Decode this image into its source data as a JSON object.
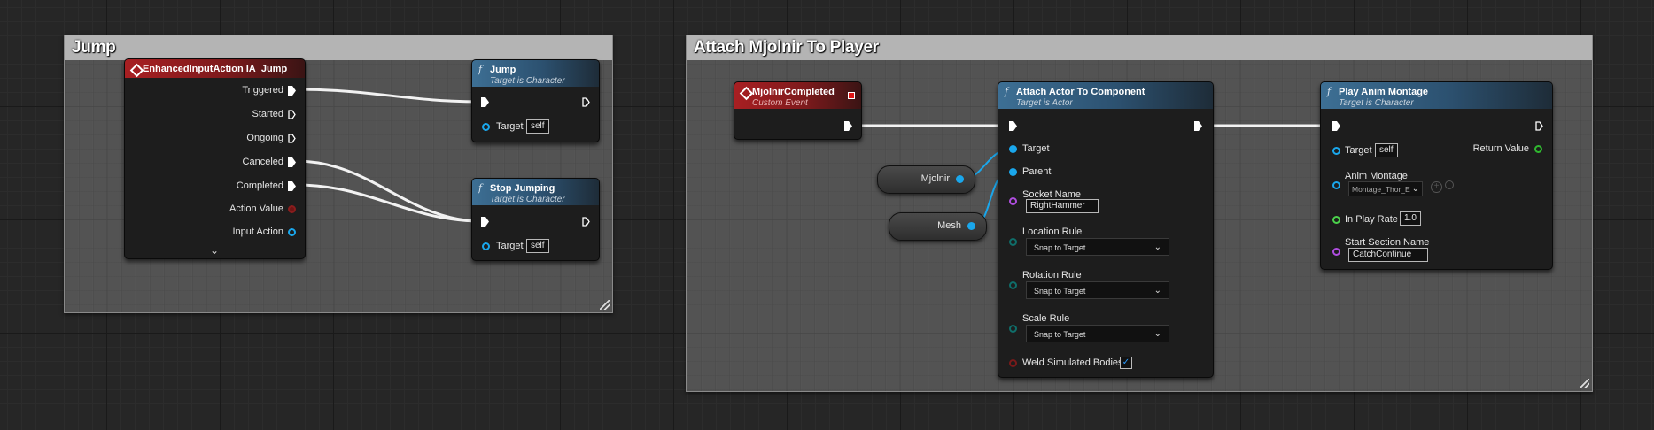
{
  "comments": {
    "jump_title": "Jump",
    "attach_title": "Attach Mjolnir To Player"
  },
  "enhanced_input": {
    "title": "EnhancedInputAction IA_Jump",
    "pins": [
      "Triggered",
      "Started",
      "Ongoing",
      "Canceled",
      "Completed",
      "Action Value",
      "Input Action"
    ]
  },
  "jump_node": {
    "title": "Jump",
    "subtitle": "Target is Character",
    "target_label": "Target",
    "target_value": "self"
  },
  "stop_jumping_node": {
    "title": "Stop Jumping",
    "subtitle": "Target is Character",
    "target_label": "Target",
    "target_value": "self"
  },
  "mjolnir_completed": {
    "title": "MjolnirCompleted",
    "subtitle": "Custom Event"
  },
  "mjolnir_var": {
    "label": "Mjolnir"
  },
  "mesh_var": {
    "label": "Mesh"
  },
  "attach_node": {
    "title": "Attach Actor To Component",
    "subtitle": "Target is Actor",
    "target_label": "Target",
    "parent_label": "Parent",
    "socket_name_label": "Socket Name",
    "socket_name_value": "RightHammer",
    "location_rule_label": "Location Rule",
    "location_rule_value": "Snap to Target",
    "rotation_rule_label": "Rotation Rule",
    "rotation_rule_value": "Snap to Target",
    "scale_rule_label": "Scale Rule",
    "scale_rule_value": "Snap to Target",
    "weld_label": "Weld Simulated Bodies",
    "weld_checked": true
  },
  "play_anim_node": {
    "title": "Play Anim Montage",
    "subtitle": "Target is Character",
    "target_label": "Target",
    "target_value": "self",
    "return_label": "Return Value",
    "anim_montage_label": "Anim Montage",
    "anim_montage_value": "Montage_Thor_E",
    "play_rate_label": "In Play Rate",
    "play_rate_value": "1.0",
    "start_section_label": "Start Section Name",
    "start_section_value": "CatchContinue"
  },
  "colors": {
    "event_header": "#a81f22",
    "function_header": "#3d6f94",
    "object_pin": "#1aa7ec",
    "name_pin": "#b04ee0",
    "byte_pin": "#0f6e6a",
    "float_pin": "#4bd24b"
  },
  "icons": {
    "event": "event-diamond-icon",
    "function": "function-f-icon",
    "expand": "chevron-down-icon",
    "checkmark": "checkmark-icon"
  }
}
